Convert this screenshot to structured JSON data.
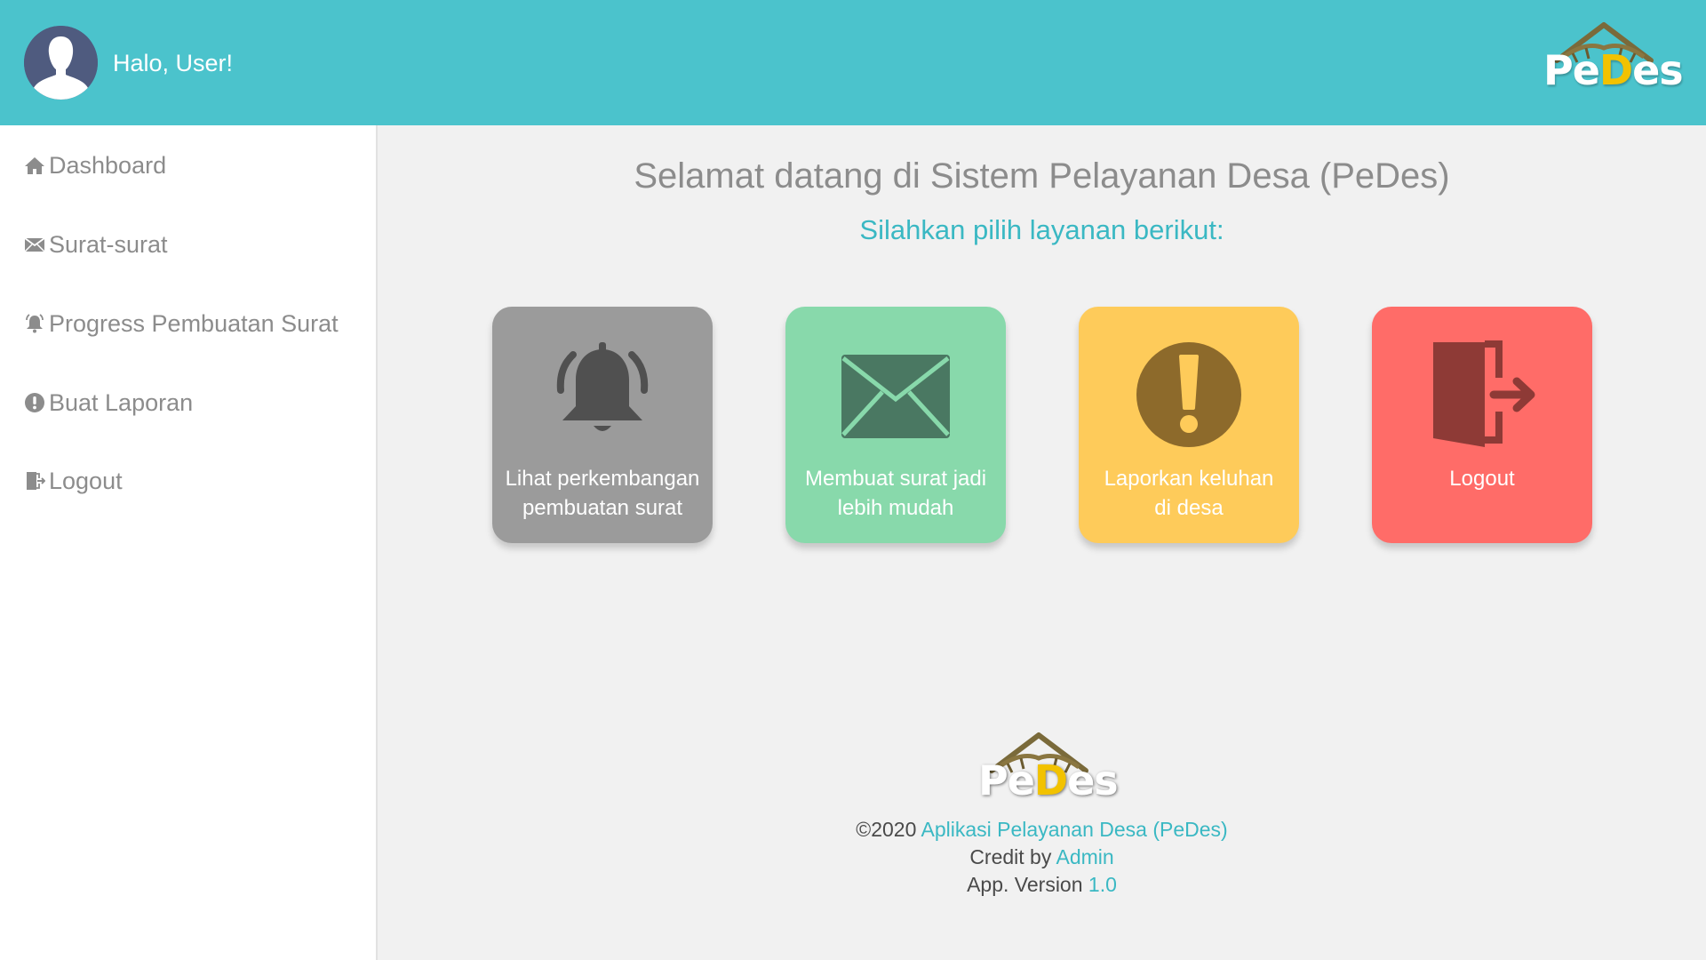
{
  "header": {
    "greeting": "Halo, User!",
    "logo": {
      "text_part1": "Pe",
      "text_part2": "D",
      "text_part3": "es"
    }
  },
  "sidebar": {
    "items": [
      {
        "label": "Dashboard",
        "icon": "home-icon"
      },
      {
        "label": "Surat-surat",
        "icon": "envelope-icon"
      },
      {
        "label": "Progress Pembuatan Surat",
        "icon": "bell-icon"
      },
      {
        "label": "Buat Laporan",
        "icon": "exclamation-circle-icon"
      },
      {
        "label": "Logout",
        "icon": "sign-out-icon"
      }
    ]
  },
  "main": {
    "title": "Selamat datang di Sistem Pelayanan Desa (PeDes)",
    "subtitle": "Silahkan pilih layanan berikut:",
    "cards": [
      {
        "label_line1": "Lihat perkembangan",
        "label_line2": "pembuatan surat",
        "icon": "bell-icon",
        "color": "#9b9b9b",
        "icon_color": "#505050"
      },
      {
        "label_line1": "Membuat surat jadi",
        "label_line2": "lebih mudah",
        "icon": "envelope-icon",
        "color": "#88d9ab",
        "icon_color": "#4a7862"
      },
      {
        "label_line1": "Laporkan keluhan",
        "label_line2": "di desa",
        "icon": "exclamation-circle-icon",
        "color": "#fecb5a",
        "icon_color": "#8d6a2b"
      },
      {
        "label_line1": "Logout",
        "label_line2": "",
        "icon": "sign-out-icon",
        "color": "#ff6c68",
        "icon_color": "#8e3a36"
      }
    ]
  },
  "footer": {
    "logo": {
      "text_part1": "Pe",
      "text_part2": "D",
      "text_part3": "es"
    },
    "copyright_prefix": "©2020",
    "app_name": "Aplikasi Pelayanan Desa (PeDes)",
    "credit_prefix": "Credit by",
    "credit_name": "Admin",
    "version_prefix": "App. Version",
    "version": "1.0"
  },
  "colors": {
    "header_bg": "#4bc3cc",
    "accent": "#3ab8c3",
    "logo_yellow": "#f2c200"
  }
}
